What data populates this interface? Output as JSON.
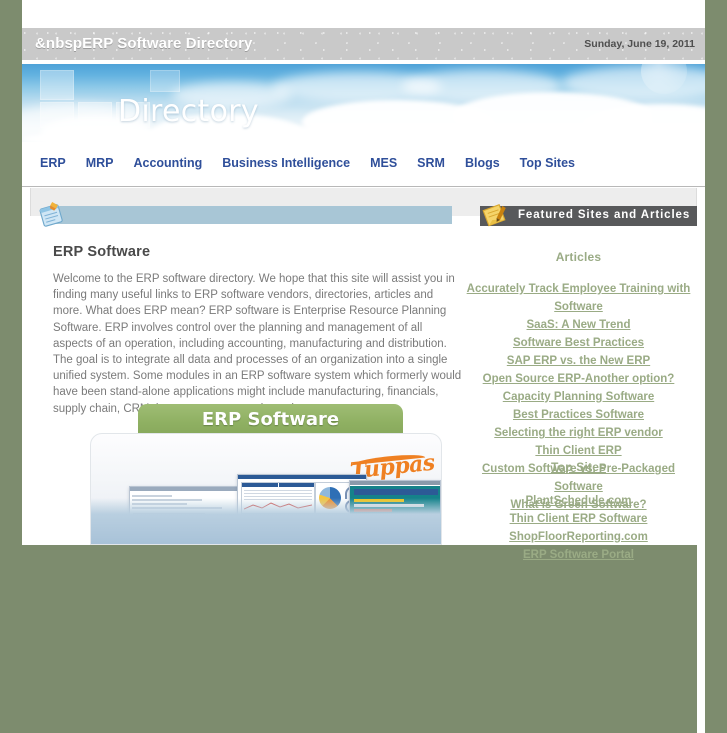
{
  "window": {
    "background_color": "#7d8c6e",
    "page_color": "#ffffff"
  },
  "header": {
    "title": "&nbspERP Software Directory",
    "date": "Sunday, June 19, 2011",
    "bar_color": "#c9c9c9"
  },
  "banner": {
    "word": "Directory",
    "sky_top_color": "#4ea2d8"
  },
  "nav": {
    "items": [
      {
        "label": "ERP"
      },
      {
        "label": "MRP"
      },
      {
        "label": "Accounting"
      },
      {
        "label": "Business Intelligence"
      },
      {
        "label": "MES"
      },
      {
        "label": "SRM"
      },
      {
        "label": "Blogs"
      },
      {
        "label": "Top Sites"
      }
    ],
    "link_color": "#2f4f9a"
  },
  "main": {
    "notepad_icon": "notepad-icon",
    "bar_color": "#a8c6d6",
    "heading": "ERP Software",
    "body": "Welcome to the ERP software directory. We hope that this site will assist you in finding many useful links to ERP software vendors, directories, articles and more. What does ERP mean? ERP software is Enterprise Resource Planning Software. ERP involves control over the planning and management of all aspects of an operation, including accounting, manufacturing and distribution. The goal is to integrate all data and processes of an organization into a single unified system. Some modules in an ERP software system which formerly would have been stand-alone applications might include manufacturing, financials, supply chain, CRM, human resouces and warehouse management.",
    "promo": {
      "tab_label": "ERP Software",
      "brand": "Tuppas",
      "tab_color": "#8fb062",
      "brand_color": "#ef8022"
    }
  },
  "sidebar": {
    "featured_bar": {
      "label": "Featured Sites and Articles",
      "icon": "pencil-pad-icon",
      "bar_color": "#58595b"
    },
    "articles_heading": "Articles",
    "articles": [
      {
        "label": "Accurately Track Employee Training with Software"
      },
      {
        "label": "SaaS: A New Trend"
      },
      {
        "label": "Software Best Practices"
      },
      {
        "label": "SAP ERP vs. the New ERP"
      },
      {
        "label": "Open Source ERP-Another option?"
      },
      {
        "label": "Capacity Planning Software"
      },
      {
        "label": "Best Practices Software"
      },
      {
        "label": "Selecting the right ERP vendor"
      },
      {
        "label": "Thin Client ERP"
      },
      {
        "label": "Custom Software vs. Pre-Packaged Software"
      },
      {
        "label": "What is Green Software?"
      }
    ],
    "topsites_heading": "Top Sites",
    "topsites": [
      {
        "label": "PlantSchedule.com"
      },
      {
        "label": "Thin Client ERP Software"
      },
      {
        "label": "ShopFloorReporting.com"
      },
      {
        "label": "ERP Software Portal"
      }
    ],
    "link_color": "#9aab85"
  }
}
